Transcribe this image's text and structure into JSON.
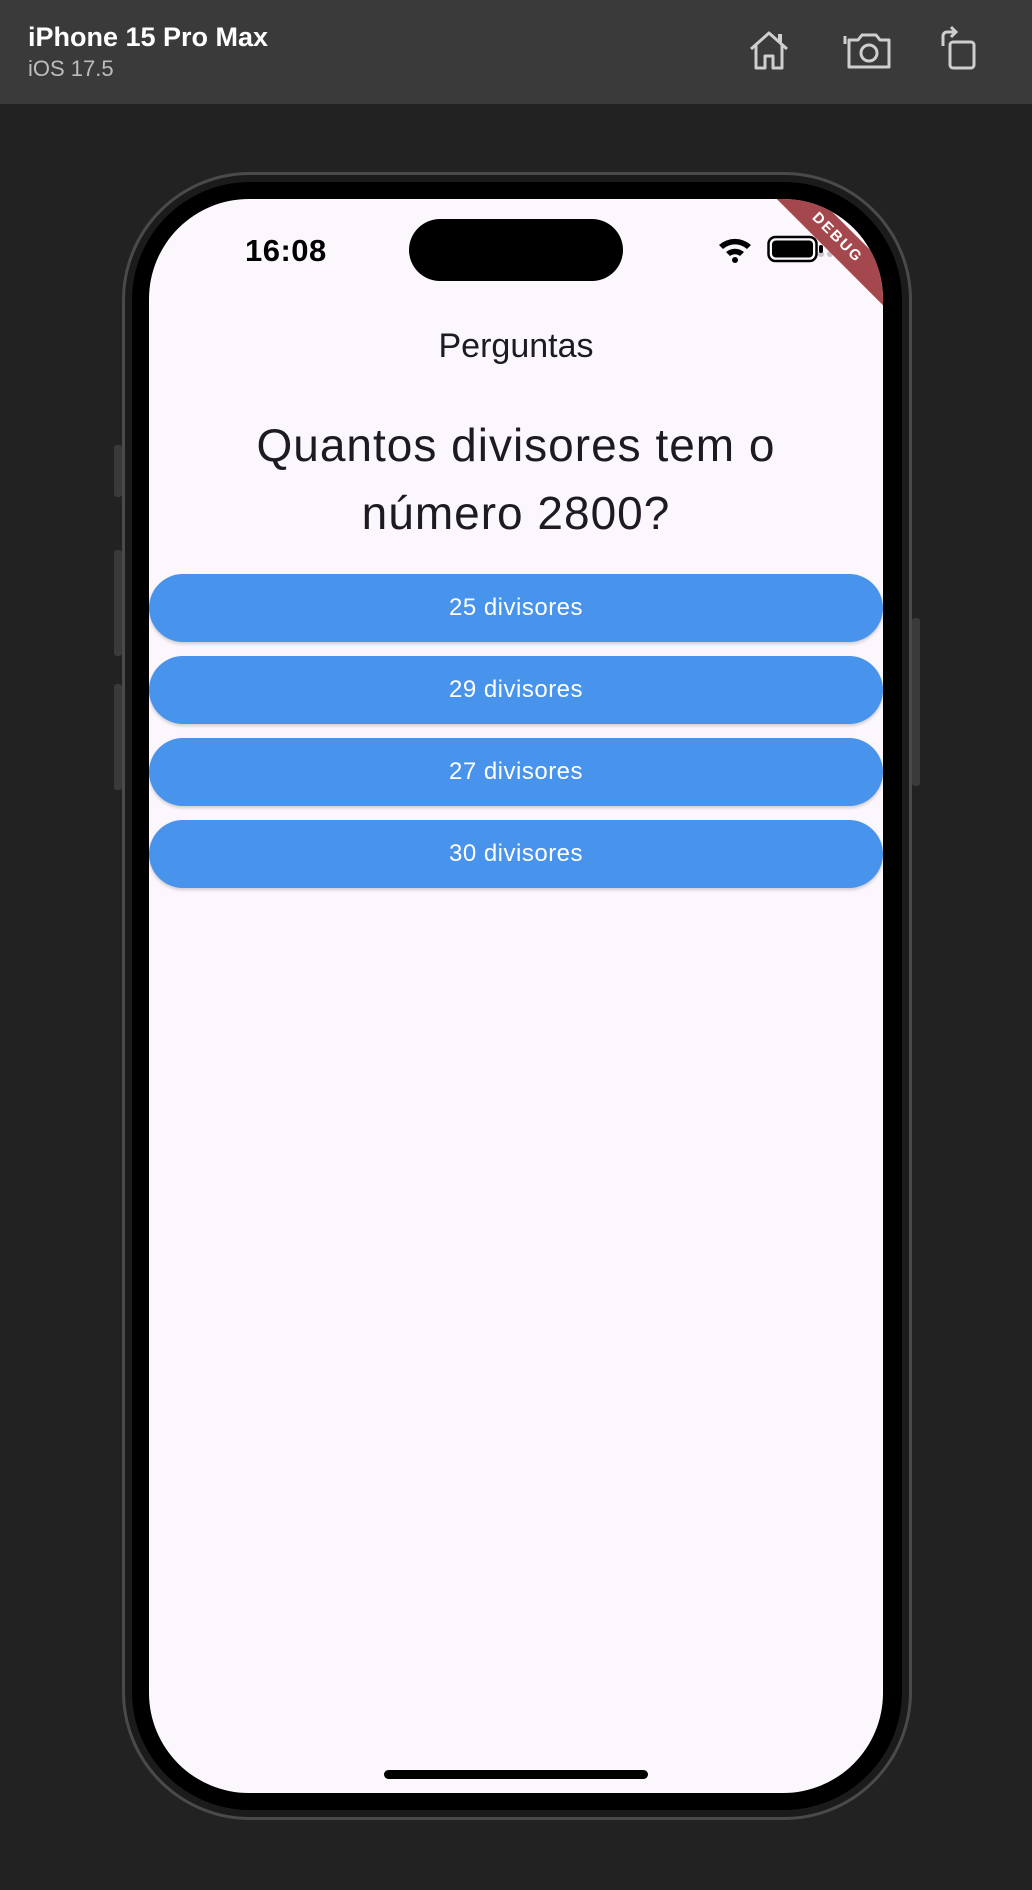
{
  "simulator": {
    "device_name": "iPhone 15 Pro Max",
    "os_version": "iOS 17.5",
    "toolbar_icons": [
      "home-icon",
      "screenshot-icon",
      "rotate-icon"
    ]
  },
  "status_bar": {
    "time": "16:08",
    "debug_label": "DEBUG",
    "icons": [
      "signal-icon",
      "wifi-icon",
      "battery-icon"
    ]
  },
  "app": {
    "title": "Perguntas",
    "question": "Quantos divisores tem o número 2800?",
    "answers": [
      {
        "label": "25 divisores"
      },
      {
        "label": "29 divisores"
      },
      {
        "label": "27 divisores"
      },
      {
        "label": "30 divisores"
      }
    ]
  },
  "colors": {
    "button": "#4893eb",
    "screen_bg": "#fcf7fd",
    "debug_banner": "#a5484d"
  }
}
